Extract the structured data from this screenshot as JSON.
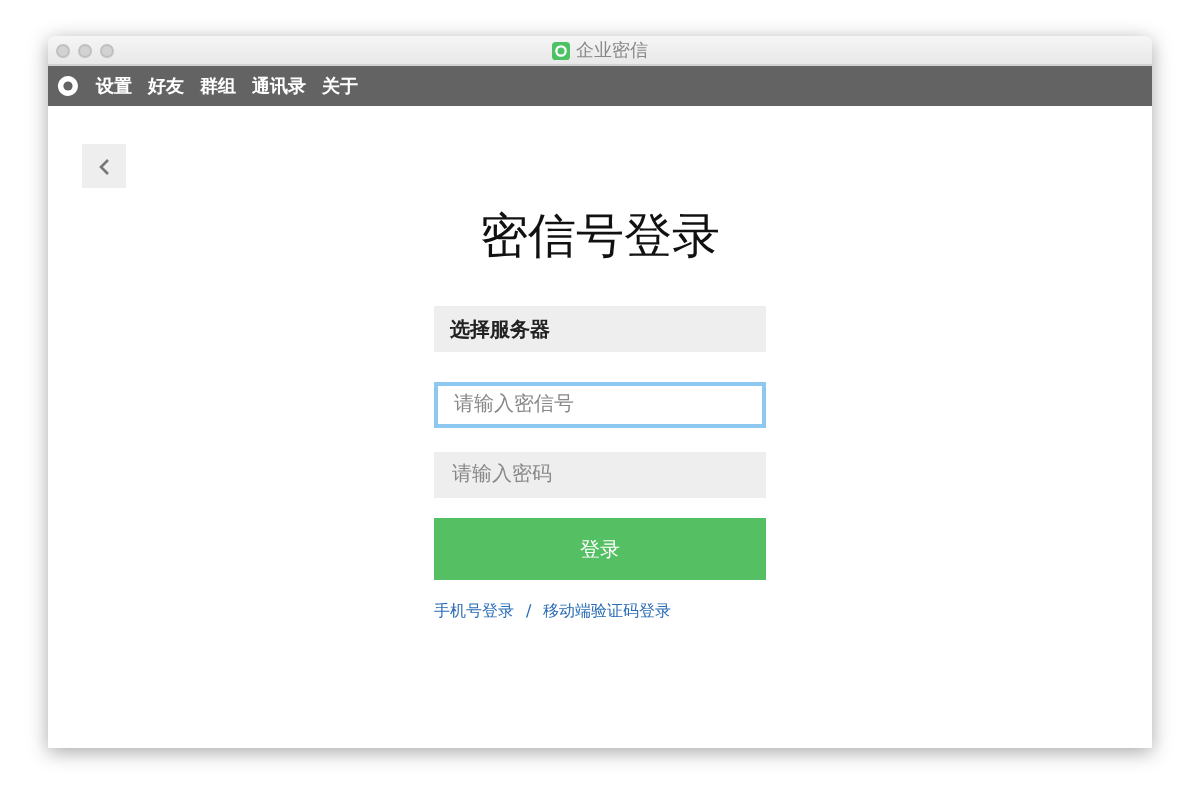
{
  "window": {
    "title": "企业密信"
  },
  "menu": {
    "items": [
      {
        "label": "设置"
      },
      {
        "label": "好友"
      },
      {
        "label": "群组"
      },
      {
        "label": "通讯录"
      },
      {
        "label": "关于"
      }
    ]
  },
  "heading": "密信号登录",
  "server_select": {
    "label": "选择服务器"
  },
  "fields": [
    {
      "placeholder": "请输入密信号",
      "focused": true
    },
    {
      "placeholder": "请输入密码",
      "focused": false
    }
  ],
  "login_button": "登录",
  "links": [
    {
      "label": "手机号登录"
    },
    {
      "label": "移动端验证码登录"
    }
  ],
  "link_separator": "/"
}
